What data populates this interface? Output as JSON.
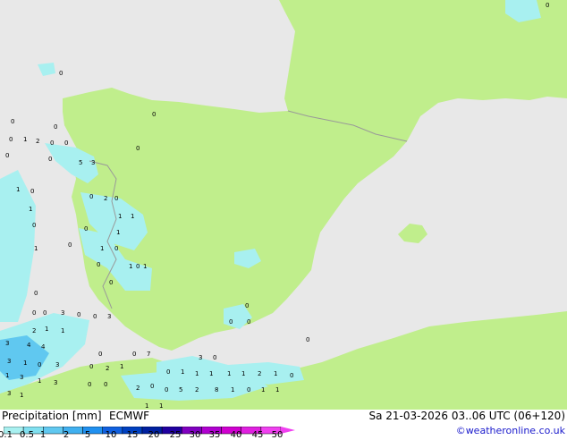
{
  "footer": {
    "title": "Precipitation [mm]",
    "model": "ECMWF",
    "datetime": "Sa 21-03-2026 03..06 UTC (06+120)",
    "credit": "©weatheronline.co.uk"
  },
  "legend": {
    "ticks": [
      "0.1",
      "0.5",
      "1",
      "2",
      "5",
      "10",
      "15",
      "20",
      "25",
      "30",
      "35",
      "40",
      "45",
      "50"
    ],
    "colors": [
      "#a8f0f0",
      "#80e0f0",
      "#60c8f0",
      "#40b0f0",
      "#2090f0",
      "#1060e0",
      "#0040c0",
      "#0020a0",
      "#2000a0",
      "#8000c0",
      "#b000d0",
      "#d000d0",
      "#e020e0",
      "#f040f0"
    ]
  },
  "map": {
    "land_color": "#c0ee8c",
    "sea_color": "#e8e8e8",
    "border_color": "#999999",
    "precip_light": "#a8f0f0",
    "precip_mid": "#80d8f0",
    "precip_heavy": "#50b0f0",
    "labels": [
      {
        "t": "0"
      },
      {
        "t": "0"
      },
      {
        "t": "0"
      },
      {
        "t": "1"
      },
      {
        "t": "2"
      },
      {
        "t": "0"
      },
      {
        "t": "0"
      },
      {
        "t": "0"
      },
      {
        "t": "0"
      },
      {
        "t": "5"
      },
      {
        "t": "3"
      },
      {
        "t": "0"
      },
      {
        "t": "1"
      },
      {
        "t": "0"
      },
      {
        "t": "0"
      },
      {
        "t": "2"
      },
      {
        "t": "0"
      },
      {
        "t": "1"
      },
      {
        "t": "1"
      },
      {
        "t": "1"
      },
      {
        "t": "0"
      },
      {
        "t": "1"
      },
      {
        "t": "0"
      },
      {
        "t": "0"
      },
      {
        "t": "1"
      },
      {
        "t": "0"
      },
      {
        "t": "1"
      },
      {
        "t": "0"
      },
      {
        "t": "0"
      },
      {
        "t": "1"
      },
      {
        "t": "1"
      },
      {
        "t": "0"
      },
      {
        "t": "0"
      },
      {
        "t": "0"
      },
      {
        "t": "3"
      },
      {
        "t": "0"
      },
      {
        "t": "0"
      },
      {
        "t": "0"
      },
      {
        "t": "3"
      },
      {
        "t": "2"
      },
      {
        "t": "1"
      },
      {
        "t": "1"
      },
      {
        "t": "3"
      },
      {
        "t": "4"
      },
      {
        "t": "4"
      },
      {
        "t": "3"
      },
      {
        "t": "1"
      },
      {
        "t": "0"
      },
      {
        "t": "3"
      },
      {
        "t": "1"
      },
      {
        "t": "3"
      },
      {
        "t": "1"
      },
      {
        "t": "3"
      },
      {
        "t": "3"
      },
      {
        "t": "1"
      },
      {
        "t": "2"
      },
      {
        "t": "1"
      },
      {
        "t": "0"
      },
      {
        "t": "0"
      },
      {
        "t": "0"
      },
      {
        "t": "0"
      },
      {
        "t": "1"
      },
      {
        "t": "1"
      },
      {
        "t": "1"
      },
      {
        "t": "1"
      },
      {
        "t": "1"
      },
      {
        "t": "2"
      },
      {
        "t": "1"
      },
      {
        "t": "2"
      },
      {
        "t": "0"
      },
      {
        "t": "0"
      },
      {
        "t": "5"
      },
      {
        "t": "2"
      },
      {
        "t": "8"
      },
      {
        "t": "1"
      },
      {
        "t": "0"
      },
      {
        "t": "1"
      },
      {
        "t": "1"
      },
      {
        "t": "1"
      },
      {
        "t": "0"
      },
      {
        "t": "7"
      },
      {
        "t": "3"
      },
      {
        "t": "0"
      },
      {
        "t": "0"
      },
      {
        "t": "0"
      },
      {
        "t": "0"
      },
      {
        "t": "0"
      },
      {
        "t": "1"
      },
      {
        "t": "0"
      },
      {
        "t": "0"
      },
      {
        "t": "0"
      },
      {
        "t": "0"
      },
      {
        "t": "0"
      }
    ]
  }
}
